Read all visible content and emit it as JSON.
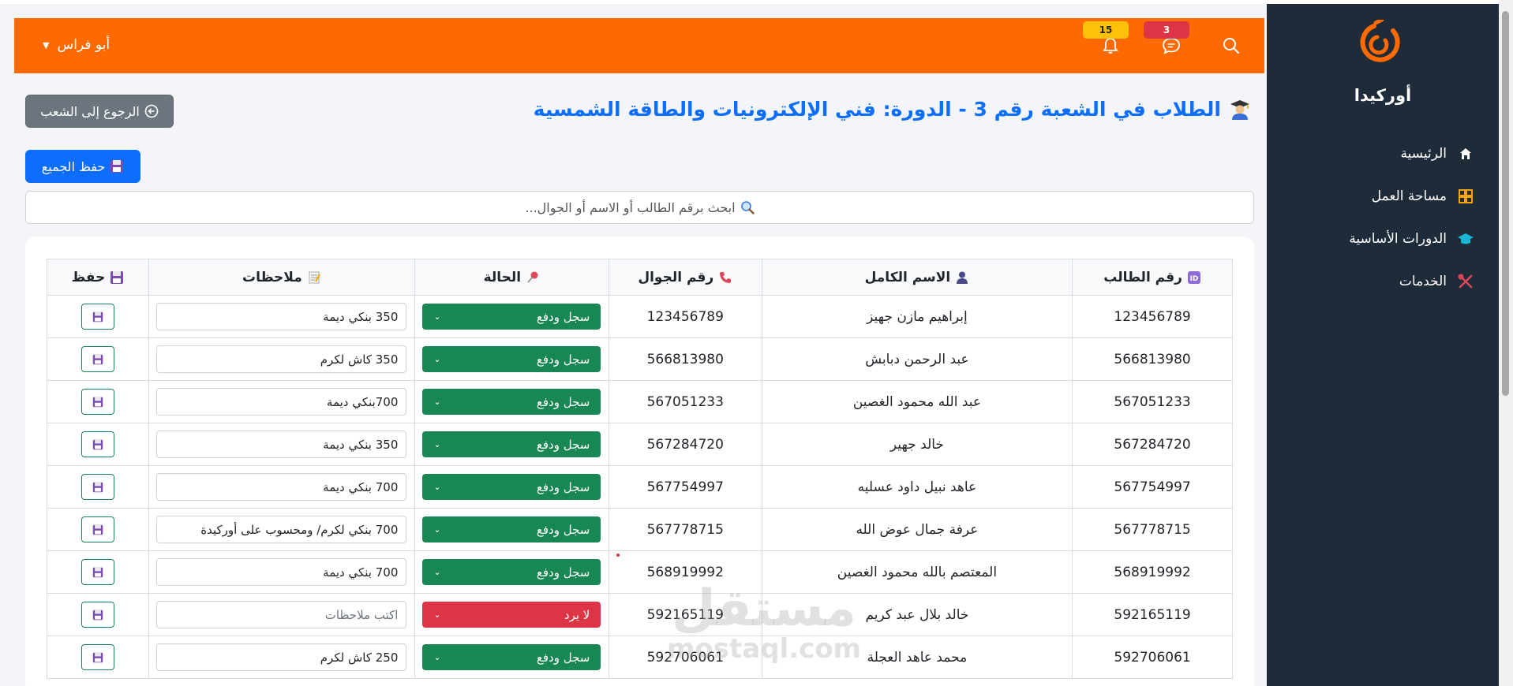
{
  "sidebar": {
    "brand": "أوركيدا",
    "items": [
      {
        "label": "الرئيسية",
        "icon": "home-icon"
      },
      {
        "label": "مساحة العمل",
        "icon": "grid-icon"
      },
      {
        "label": "الدورات الأساسية",
        "icon": "graduation-cap-icon"
      },
      {
        "label": "الخدمات",
        "icon": "tools-icon"
      }
    ]
  },
  "topbar": {
    "user_name": "أبو فراس",
    "notifications_count": "15",
    "messages_count": "3",
    "accent": "#ff6a00"
  },
  "page": {
    "title": "الطلاب في الشعبة رقم 3 - الدورة: فني الإلكترونيات والطاقة الشمسية",
    "back_button": "الرجوع إلى الشعب",
    "save_all_button": "حفظ الجميع",
    "search_placeholder": "ابحث برقم الطالب أو الاسم أو الجوال..."
  },
  "table": {
    "headers": {
      "student_id": "رقم الطالب",
      "full_name": "الاسم الكامل",
      "phone": "رقم الجوال",
      "status": "الحالة",
      "notes": "ملاحظات",
      "save": "حفظ"
    },
    "notes_placeholder": "اكتب ملاحظات",
    "rows": [
      {
        "id": "123456789",
        "name": "إبراهيم مازن جهيز",
        "phone": "123456789",
        "status": "سجل ودفع",
        "status_color": "green",
        "note": "350 بنكي ديمة"
      },
      {
        "id": "566813980",
        "name": "عبد الرحمن دبابش",
        "phone": "566813980",
        "status": "سجل ودفع",
        "status_color": "green",
        "note": "350 كاش لكرم"
      },
      {
        "id": "567051233",
        "name": "عبد الله محمود الغصين",
        "phone": "567051233",
        "status": "سجل ودفع",
        "status_color": "green",
        "note": "700بنكي ديمة"
      },
      {
        "id": "567284720",
        "name": "خالد جهير",
        "phone": "567284720",
        "status": "سجل ودفع",
        "status_color": "green",
        "note": "350 بنكي ديمة"
      },
      {
        "id": "567754997",
        "name": "عاهد نبيل داود عسليه",
        "phone": "567754997",
        "status": "سجل ودفع",
        "status_color": "green",
        "note": "700 بنكي ديمة"
      },
      {
        "id": "567778715",
        "name": "عرفة جمال عوض الله",
        "phone": "567778715",
        "status": "سجل ودفع",
        "status_color": "green",
        "note": "700 بنكي لكرم/ ومحسوب على أوركيدة"
      },
      {
        "id": "568919992",
        "name": "المعتصم بالله محمود الغصين",
        "phone": "568919992",
        "status": "سجل ودفع",
        "status_color": "green",
        "note": "700 بنكي ديمة"
      },
      {
        "id": "592165119",
        "name": "خالد بلال عبد كريم",
        "phone": "592165119",
        "status": "لا يرد",
        "status_color": "red",
        "note": ""
      },
      {
        "id": "592706061",
        "name": "محمد عاهد العجلة",
        "phone": "592706061",
        "status": "سجل ودفع",
        "status_color": "green",
        "note": "250 كاش لكرم"
      }
    ]
  },
  "watermark": {
    "text": "مستقل",
    "sub": "mostaql.com"
  }
}
